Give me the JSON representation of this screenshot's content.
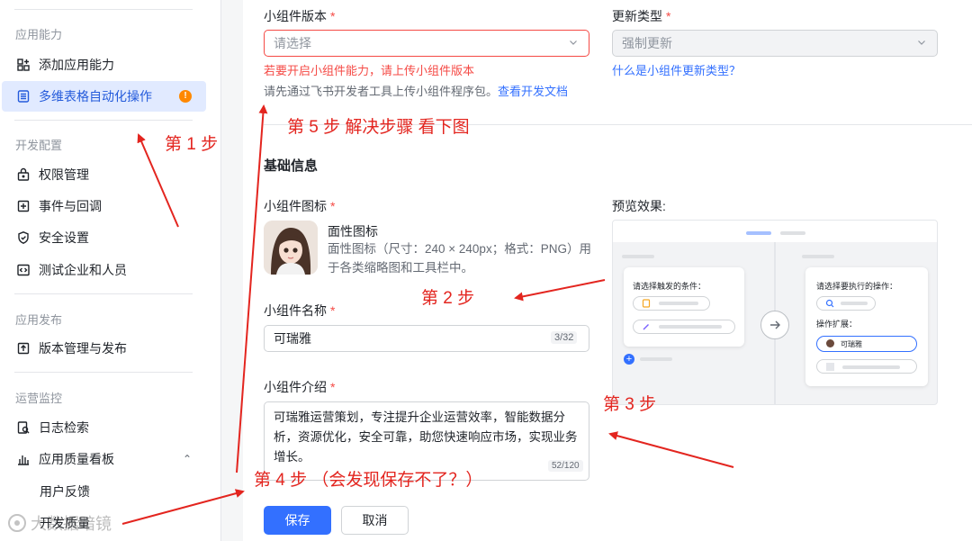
{
  "sidebar": {
    "sections": [
      {
        "title": "应用能力"
      },
      {
        "title": "开发配置"
      },
      {
        "title": "应用发布"
      },
      {
        "title": "运营监控"
      }
    ],
    "items": {
      "add_capability": "添加应用能力",
      "bitable_automation": "多维表格自动化操作",
      "bitable_badge": "!",
      "permissions": "权限管理",
      "events": "事件与回调",
      "security": "安全设置",
      "test_enterprise": "测试企业和人员",
      "version": "版本管理与发布",
      "logs": "日志检索",
      "quality": "应用质量看板",
      "feedback": "用户反馈",
      "cut_off": "开发质量"
    },
    "watermark": "大数据暗镜"
  },
  "form": {
    "widget_version": {
      "label": "小组件版本",
      "placeholder": "请选择",
      "error": "若要开启小组件能力，请上传小组件版本",
      "hint": "请先通过飞书开发者工具上传小组件程序包。",
      "hint_link": "查看开发文档"
    },
    "update_type": {
      "label": "更新类型",
      "value": "强制更新",
      "help_link": "什么是小组件更新类型？"
    },
    "basic_info_title": "基础信息",
    "widget_icon": {
      "label": "小组件图标",
      "title": "面性图标",
      "desc": "面性图标（尺寸：240 × 240px；格式：PNG）用于各类缩略图和工具栏中。"
    },
    "preview_label": "预览效果:",
    "widget_name": {
      "label": "小组件名称",
      "value": "可瑞雅",
      "counter": "3/32"
    },
    "widget_intro": {
      "label": "小组件介绍",
      "value": "可瑞雅运营策划，专注提升企业运营效率，智能数据分析，资源优化，安全可靠，助您快速响应市场，实现业务增长。",
      "counter": "52/120"
    },
    "required_mark": "*",
    "save_label": "保存",
    "cancel_label": "取消"
  },
  "preview": {
    "trigger_title": "请选择触发的条件：",
    "action_title": "请选择要执行的操作：",
    "ext_title": "操作扩展：",
    "user_name": "可瑞雅"
  },
  "annotations": {
    "step1": "第 1 步",
    "step2": "第 2 步",
    "step3": "第 3 步",
    "step4": "第 4 步  （会发现保存不了？）",
    "step5": "第 5 步 解决步骤 看下图"
  },
  "colors": {
    "primary": "#3370ff",
    "error": "#f54a45",
    "annotation": "#e3251f",
    "active_bg": "#e1eaff"
  }
}
